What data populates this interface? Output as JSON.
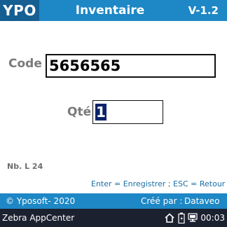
{
  "header": {
    "brand": "YPO",
    "title": "Inventaire",
    "version": "V-1.2"
  },
  "form": {
    "code_label": "Code",
    "code_value": "5656565",
    "qty_label": "Qté",
    "qty_value": "1"
  },
  "status": {
    "line_count": "Nb. L 24",
    "shortcuts": "Enter = Enregistrer ;  ESC = Retour"
  },
  "footer": {
    "copyright": "© Yposoft- 2020",
    "created_by_label": "Créé par :",
    "created_by_value": "Dataveo"
  },
  "system_bar": {
    "app_name": "Zebra AppCenter",
    "time": "00:03",
    "icons": [
      "home-icon",
      "battery-icon",
      "network-icon"
    ]
  },
  "colors": {
    "title_bar": "#1e87c5",
    "brand_block": "#155f92",
    "system_bar": "#1c2130",
    "selection": "#0a246a",
    "shortcut_text": "#1b6fa6"
  }
}
